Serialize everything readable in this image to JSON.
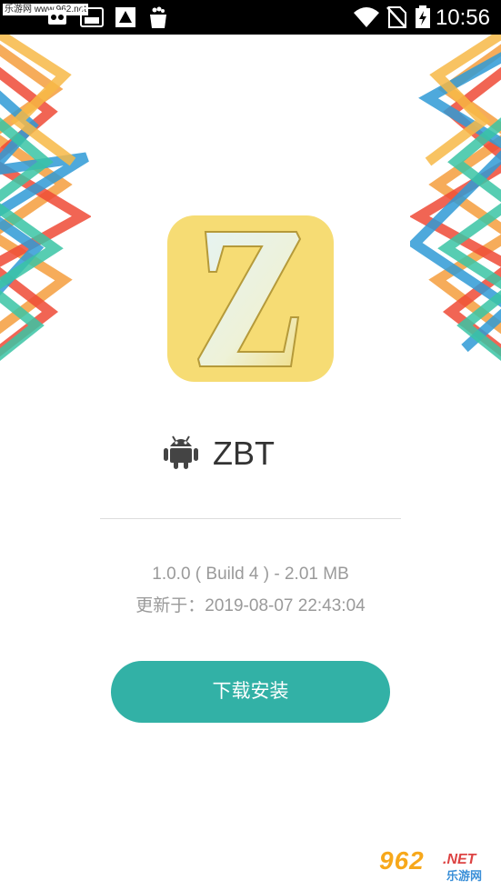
{
  "status_bar": {
    "time": "10:56",
    "icons": [
      "notification-app-icon",
      "games-icon",
      "app-store-icon",
      "sailing-icon",
      "bag-icon",
      "wifi-icon",
      "no-sim-icon",
      "battery-charging-icon"
    ]
  },
  "watermark_top": "乐游网 www.962.net",
  "app": {
    "name": "ZBT",
    "icon_letter": "Z",
    "version_info": "1.0.0 ( Build 4 ) - 2.01 MB",
    "updated": "更新于：2019-08-07 22:43:04"
  },
  "download_label": "下载安装",
  "watermark_bottom": {
    "num": "962",
    "net": ".NET",
    "cn": "乐游网"
  },
  "colors": {
    "accent": "#32b1a6",
    "icon_bg": "#f6dc74",
    "deco": [
      "#f59d3d",
      "#ef4a36",
      "#2f9ad6",
      "#3ac4a4",
      "#f7b946"
    ]
  }
}
